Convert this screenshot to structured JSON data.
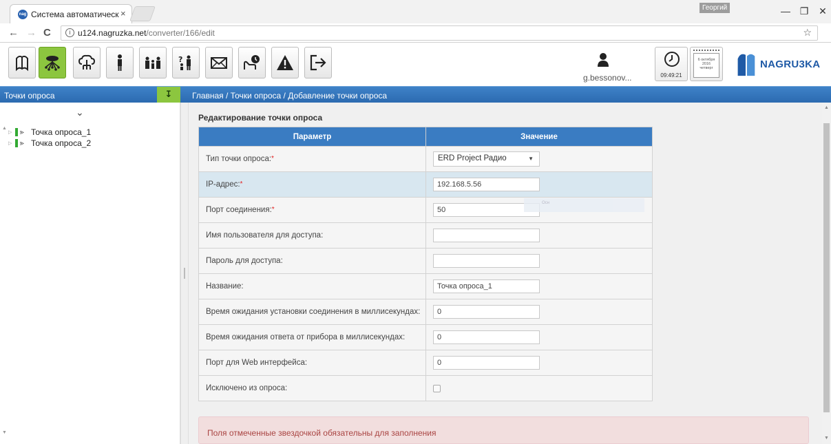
{
  "browser": {
    "tab_title": "Система автоматическо",
    "tab_close": "×",
    "favicon": "nag",
    "window_user": "Георгий",
    "min": "—",
    "restore": "❐",
    "close": "✕",
    "back": "←",
    "forward": "→",
    "reload": "C",
    "info": "i",
    "url_host": "u124.nagruzka.net",
    "url_path": "/converter/166/edit",
    "star": "☆",
    "menu": "⋮"
  },
  "toolbar": {
    "buttons": [
      {
        "icon": "book-icon"
      },
      {
        "icon": "network-icon",
        "active": true
      },
      {
        "icon": "cloud-tree-icon"
      },
      {
        "icon": "person-icon"
      },
      {
        "icon": "people-icon"
      },
      {
        "icon": "user-question-icon"
      },
      {
        "icon": "mail-icon"
      },
      {
        "icon": "hand-clock-icon"
      },
      {
        "icon": "warning-icon"
      },
      {
        "icon": "logout-icon"
      }
    ],
    "user_name": "g.bessonov...",
    "time": "09:49:21",
    "calendar_day": "6 октября",
    "calendar_year": "2016",
    "calendar_weekday": "четверг",
    "brand": "NAGRU3KA",
    "brand_color": "#1f5aa6"
  },
  "sidebar": {
    "title": "Точки опроса",
    "collapse": "↧",
    "chevron": "⌄",
    "items": [
      {
        "label": "Точка опроса_1"
      },
      {
        "label": "Точка опроса_2"
      }
    ]
  },
  "breadcrumb": "Главная  /  Точки опроса  / Добавление точки опроса",
  "form": {
    "title": "Редактирование точки опроса",
    "col_param": "Параметр",
    "col_value": "Значение",
    "rows": [
      {
        "label": "Тип точки опроса:",
        "required": true,
        "type": "select",
        "value": "ERD Project Радио"
      },
      {
        "label": "IP-адрес:",
        "required": true,
        "type": "text",
        "value": "192.168.5.56"
      },
      {
        "label": "Порт соединения:",
        "required": true,
        "type": "text",
        "value": "50"
      },
      {
        "label": "Имя пользователя для доступа:",
        "required": false,
        "type": "text",
        "value": ""
      },
      {
        "label": "Пароль для доступа:",
        "required": false,
        "type": "text",
        "value": ""
      },
      {
        "label": "Название:",
        "required": false,
        "type": "text",
        "value": "Точка опроса_1"
      },
      {
        "label": "Время ожидания установки соединения в миллисекундах:",
        "required": false,
        "type": "text",
        "value": "0"
      },
      {
        "label": "Время ожидания ответа от прибора в миллисекундах:",
        "required": false,
        "type": "text",
        "value": "0"
      },
      {
        "label": "Порт для Web интерфейса:",
        "required": false,
        "type": "text",
        "value": "0"
      },
      {
        "label": "Исключено из опроса:",
        "required": false,
        "type": "checkbox",
        "value": false
      }
    ],
    "ghost_text": "Осн",
    "alert": "Поля отмеченные звездочкой обязательны для заполнения"
  },
  "colors": {
    "accent_green": "#8cc63f",
    "header_blue": "#2c6bb0",
    "required_red": "#e02020"
  }
}
